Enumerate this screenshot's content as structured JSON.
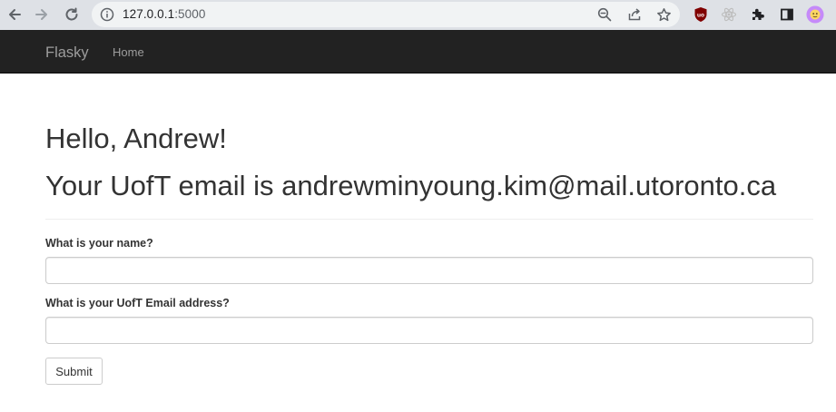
{
  "browser": {
    "url_host": "127.0.0.1",
    "url_port": ":5000"
  },
  "navbar": {
    "brand": "Flasky",
    "home_label": "Home"
  },
  "main": {
    "greeting": "Hello, Andrew!",
    "email_line": "Your UofT email is andrewminyoung.kim@mail.utoronto.ca"
  },
  "form": {
    "name_label": "What is your name?",
    "name_value": "",
    "email_label": "What is your UofT Email address?",
    "email_value": "",
    "submit_label": "Submit"
  },
  "colors": {
    "navbar_bg": "#222222",
    "nav_text": "#9d9d9d",
    "text": "#333333",
    "chrome_bg": "#dee1e6"
  }
}
